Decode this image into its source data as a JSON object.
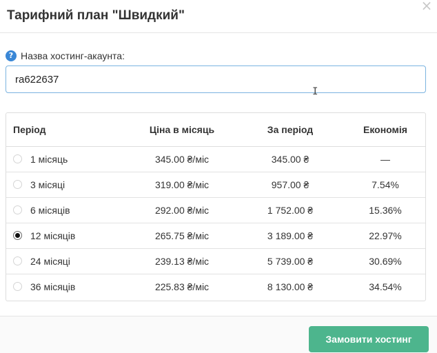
{
  "modal": {
    "title": "Тарифний план \"Швидкий\"",
    "close_icon": "×"
  },
  "account_field": {
    "help_icon": "?",
    "label": "Назва хостинг-акаунта:",
    "value": "ra622637"
  },
  "table": {
    "headers": {
      "period": "Період",
      "monthly_price": "Ціна в місяць",
      "period_total": "За період",
      "savings": "Економія"
    },
    "rows": [
      {
        "period": "1 місяць",
        "monthly_price": "345.00 ₴/міс",
        "period_total": "345.00 ₴",
        "savings": "—",
        "selected": false
      },
      {
        "period": "3 місяці",
        "monthly_price": "319.00 ₴/міс",
        "period_total": "957.00 ₴",
        "savings": "7.54%",
        "selected": false
      },
      {
        "period": "6 місяців",
        "monthly_price": "292.00 ₴/міс",
        "period_total": "1 752.00 ₴",
        "savings": "15.36%",
        "selected": false
      },
      {
        "period": "12 місяців",
        "monthly_price": "265.75 ₴/міс",
        "period_total": "3 189.00 ₴",
        "savings": "22.97%",
        "selected": true
      },
      {
        "period": "24 місяці",
        "monthly_price": "239.13 ₴/міс",
        "period_total": "5 739.00 ₴",
        "savings": "30.69%",
        "selected": false
      },
      {
        "period": "36 місяців",
        "monthly_price": "225.83 ₴/міс",
        "period_total": "8 130.00 ₴",
        "savings": "34.54%",
        "selected": false
      }
    ]
  },
  "footer": {
    "order_button": "Замовити хостинг"
  },
  "colors": {
    "accent_button": "#4db58d",
    "help_icon": "#3a87d6",
    "input_border": "#7ab3e0"
  },
  "icons": {
    "close": "close-icon",
    "help": "help-icon",
    "text_cursor": "ibeam-cursor-icon"
  }
}
